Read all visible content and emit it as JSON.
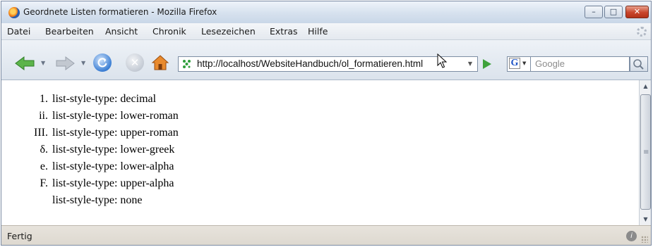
{
  "window": {
    "title": "Geordnete Listen formatieren - Mozilla Firefox",
    "controls": {
      "minimize": "–",
      "maximize": "□",
      "close": "✕"
    }
  },
  "menu": {
    "items": [
      "Datei",
      "Bearbeiten",
      "Ansicht",
      "Chronik",
      "Lesezeichen",
      "Extras",
      "Hilfe"
    ]
  },
  "toolbar": {
    "url": "http://localhost/WebsiteHandbuch/ol_formatieren.html",
    "search_engine_letter": "G",
    "search_placeholder": "Google"
  },
  "content": {
    "list_items": [
      {
        "marker": "1.",
        "text": "list-style-type: decimal"
      },
      {
        "marker": "ii.",
        "text": "list-style-type: lower-roman"
      },
      {
        "marker": "III.",
        "text": "list-style-type: upper-roman"
      },
      {
        "marker": "δ.",
        "text": "list-style-type: lower-greek"
      },
      {
        "marker": "e.",
        "text": "list-style-type: lower-alpha"
      },
      {
        "marker": "F.",
        "text": "list-style-type: upper-alpha"
      },
      {
        "marker": "",
        "text": "list-style-type: none"
      }
    ]
  },
  "status": {
    "text": "Fertig"
  },
  "icons": {
    "back": "arrow-left-icon",
    "forward": "arrow-right-icon",
    "reload": "reload-icon",
    "stop": "stop-icon",
    "home": "home-icon",
    "go": "go-arrow-icon",
    "search": "magnifier-icon"
  }
}
